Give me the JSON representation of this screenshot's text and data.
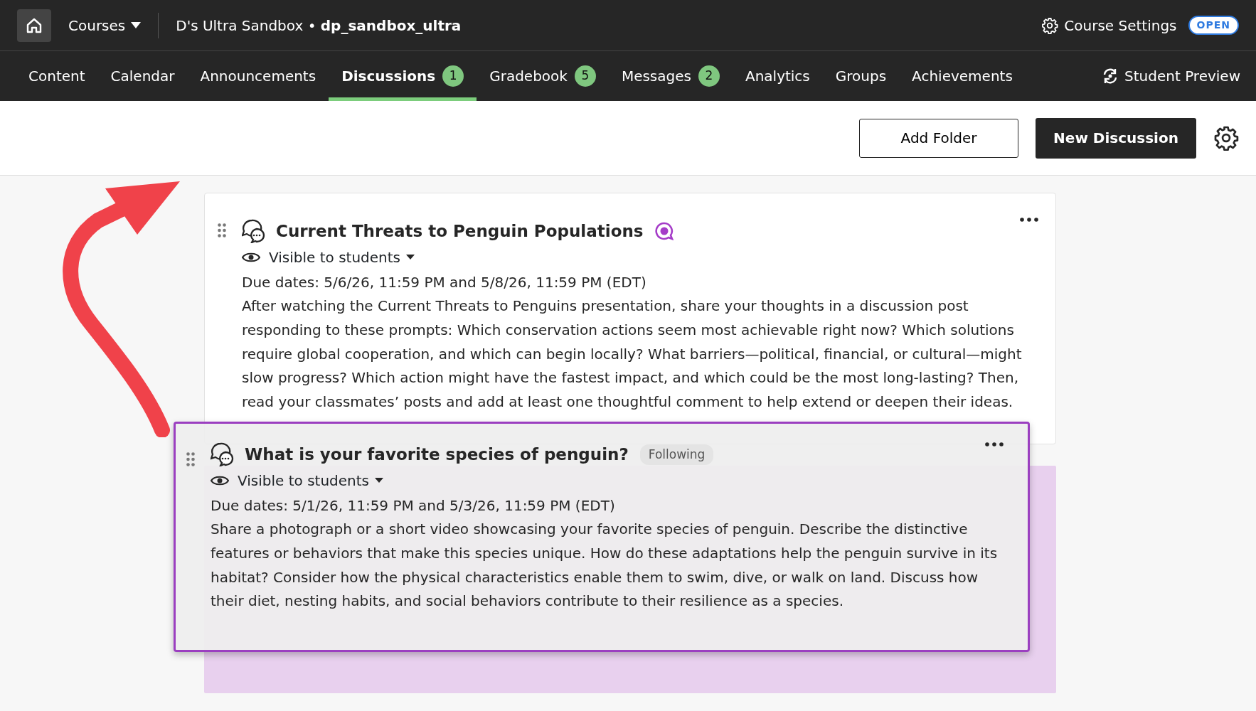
{
  "top_bar": {
    "courses_menu": "Courses",
    "course_name": "D's Ultra Sandbox •",
    "course_id": "dp_sandbox_ultra",
    "settings_link": "Course Settings",
    "status_badge": "OPEN"
  },
  "tabs": [
    {
      "label": "Content",
      "selected": false
    },
    {
      "label": "Calendar",
      "selected": false
    },
    {
      "label": "Announcements",
      "selected": false
    },
    {
      "label": "Discussions",
      "selected": true,
      "count": "1"
    },
    {
      "label": "Gradebook",
      "selected": false,
      "count": "5"
    },
    {
      "label": "Messages",
      "selected": false,
      "count": "2"
    },
    {
      "label": "Analytics",
      "selected": false
    },
    {
      "label": "Groups",
      "selected": false
    },
    {
      "label": "Achievements",
      "selected": false
    }
  ],
  "student_preview": "Student Preview",
  "toolbar": {
    "buttons": [
      "Add Folder",
      "New Discussion"
    ]
  },
  "discussions": [
    {
      "title": "Current Threats to Penguin Populations",
      "participation_mark": true,
      "following": false,
      "dragging": false,
      "visibility": "Visible to students",
      "due": "Due dates: 5/6/26, 11:59 PM and 5/8/26, 11:59 PM (EDT)",
      "description": "After watching the Current Threats to Penguins presentation, share your thoughts in a discussion post responding to these prompts: Which conservation actions seem most achievable right now? Which solutions require global cooperation, and which can begin locally? What barriers—political, financial, or cultural—might slow progress? Which action might have the fastest impact, and which could be the most long-lasting? Then, read your classmates’ posts and add at least one thoughtful comment to help extend or deepen their ideas."
    },
    {
      "title": "What is your favorite species of penguin?",
      "participation_mark": false,
      "following": true,
      "following_label": "Following",
      "dragging": true,
      "visibility": "Visible to students",
      "due": "Due dates: 5/1/26, 11:59 PM and 5/3/26, 11:59 PM (EDT)",
      "description": "Share a photograph or a short video showcasing your favorite species of penguin. Describe the distinctive features or behaviors that make this species unique. How do these adaptations help the penguin survive in its habitat? Consider how the physical characteristics enable them to swim, dive, or walk on land. Discuss how their diet, nesting habits, and social behaviors contribute to their resilience as a species."
    }
  ]
}
